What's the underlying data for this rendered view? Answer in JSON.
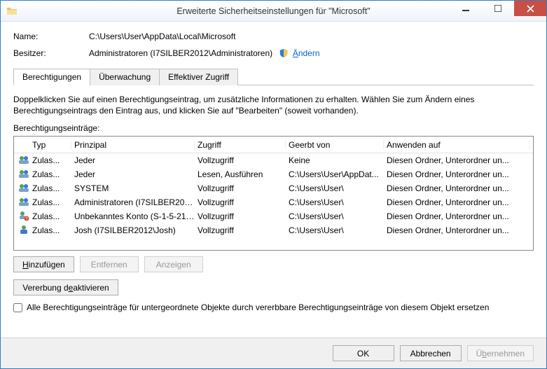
{
  "window": {
    "title": "Erweiterte Sicherheitseinstellungen für \"Microsoft\""
  },
  "info": {
    "name_label": "Name:",
    "name_value": "C:\\Users\\User\\AppData\\Local\\Microsoft",
    "owner_label": "Besitzer:",
    "owner_value": "Administratoren (I7SILBER2012\\Administratoren)",
    "change_link": "Ändern"
  },
  "tabs": {
    "permissions": "Berechtigungen",
    "auditing": "Überwachung",
    "effective": "Effektiver Zugriff"
  },
  "description": "Doppelklicken Sie auf einen Berechtigungseintrag, um zusätzliche Informationen zu erhalten. Wählen Sie zum Ändern eines Berechtigungseintrags den Eintrag aus, und klicken Sie auf \"Bearbeiten\" (soweit vorhanden).",
  "entries_label": "Berechtigungseinträge:",
  "columns": {
    "type": "Typ",
    "principal": "Prinzipal",
    "access": "Zugriff",
    "inherited": "Geerbt von",
    "applies": "Anwenden auf"
  },
  "rows": [
    {
      "icon": "group",
      "type": "Zulas...",
      "principal": "Jeder",
      "access": "Vollzugriff",
      "inherited": "Keine",
      "applies": "Diesen Ordner, Unterordner un..."
    },
    {
      "icon": "group",
      "type": "Zulas...",
      "principal": "Jeder",
      "access": "Lesen, Ausführen",
      "inherited": "C:\\Users\\User\\AppDat...",
      "applies": "Diesen Ordner, Unterordner un..."
    },
    {
      "icon": "group",
      "type": "Zulas...",
      "principal": "SYSTEM",
      "access": "Vollzugriff",
      "inherited": "C:\\Users\\User\\",
      "applies": "Diesen Ordner, Unterordner un..."
    },
    {
      "icon": "group",
      "type": "Zulas...",
      "principal": "Administratoren (I7SILBER201...",
      "access": "Vollzugriff",
      "inherited": "C:\\Users\\User\\",
      "applies": "Diesen Ordner, Unterordner un..."
    },
    {
      "icon": "unknown",
      "type": "Zulas...",
      "principal": "Unbekanntes Konto (S-1-5-21-...",
      "access": "Vollzugriff",
      "inherited": "C:\\Users\\User\\",
      "applies": "Diesen Ordner, Unterordner un..."
    },
    {
      "icon": "user",
      "type": "Zulas...",
      "principal": "Josh (I7SILBER2012\\Josh)",
      "access": "Vollzugriff",
      "inherited": "C:\\Users\\User\\",
      "applies": "Diesen Ordner, Unterordner un..."
    }
  ],
  "buttons": {
    "add": "Hinzufügen",
    "remove": "Entfernen",
    "view": "Anzeigen",
    "disable_inherit": "Vererbung deaktivieren",
    "replace_check": "Alle Berechtigungseinträge für untergeordnete Objekte durch vererbbare Berechtigungseinträge von diesem Objekt ersetzen",
    "ok": "OK",
    "cancel": "Abbrechen",
    "apply": "Übernehmen"
  }
}
